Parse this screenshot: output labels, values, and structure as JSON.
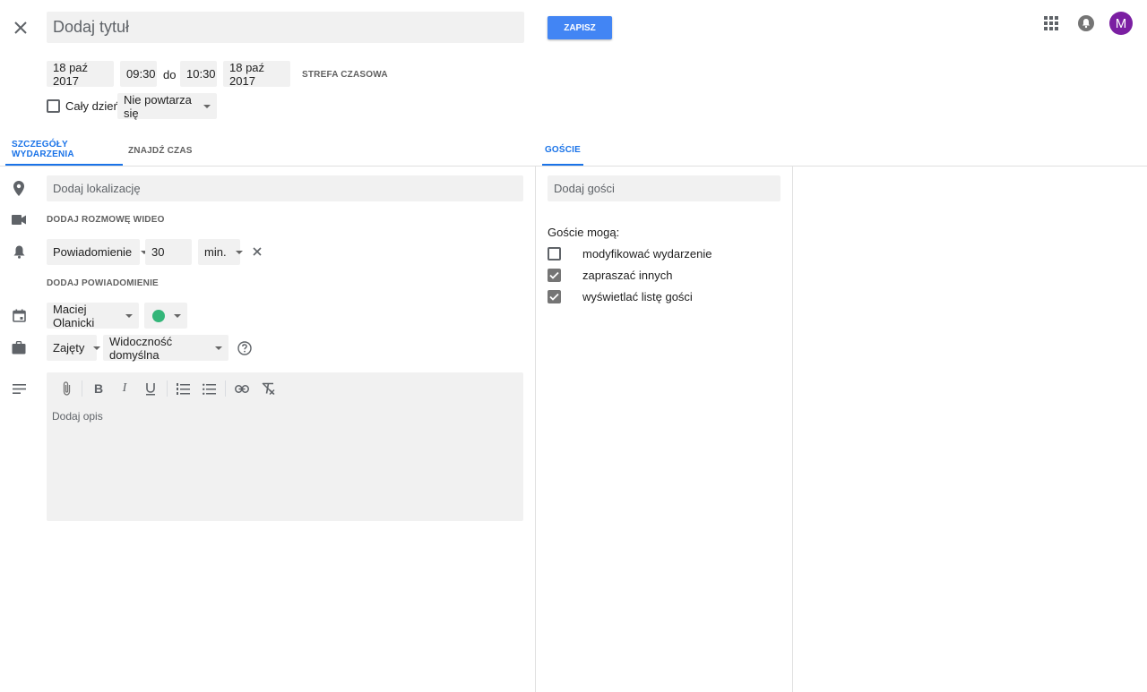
{
  "header": {
    "title_placeholder": "Dodaj tytuł",
    "save_label": "ZAPISZ",
    "avatar_letter": "M",
    "avatar_color": "#7b1fa2",
    "accent_color": "#4285f4"
  },
  "datetime": {
    "start_date": "18 paź 2017",
    "start_time": "09:30",
    "to_label": "do",
    "end_time": "10:30",
    "end_date": "18 paź 2017",
    "timezone_label": "STREFA CZASOWA",
    "all_day_label": "Cały dzień",
    "repeat_value": "Nie powtarza się"
  },
  "tabs": {
    "details": "SZCZEGÓŁY WYDARZENIA",
    "find_time": "ZNAJDŹ CZAS",
    "guests": "GOŚCIE"
  },
  "details": {
    "location_placeholder": "Dodaj lokalizację",
    "video_label": "DODAJ ROZMOWĘ WIDEO",
    "notification_type": "Powiadomienie",
    "notification_amount": "30",
    "notification_unit": "min.",
    "add_notification_label": "DODAJ POWIADOMIENIE",
    "calendar_owner": "Maciej Olanicki",
    "event_color": "#33b679",
    "busy_status": "Zajęty",
    "visibility": "Widoczność domyślna",
    "description_placeholder": "Dodaj opis"
  },
  "guests": {
    "add_placeholder": "Dodaj gości",
    "permissions_title": "Goście mogą:",
    "permissions": [
      {
        "label": "modyfikować wydarzenie",
        "checked": false
      },
      {
        "label": "zapraszać innych",
        "checked": true
      },
      {
        "label": "wyświetlać listę gości",
        "checked": true
      }
    ]
  }
}
